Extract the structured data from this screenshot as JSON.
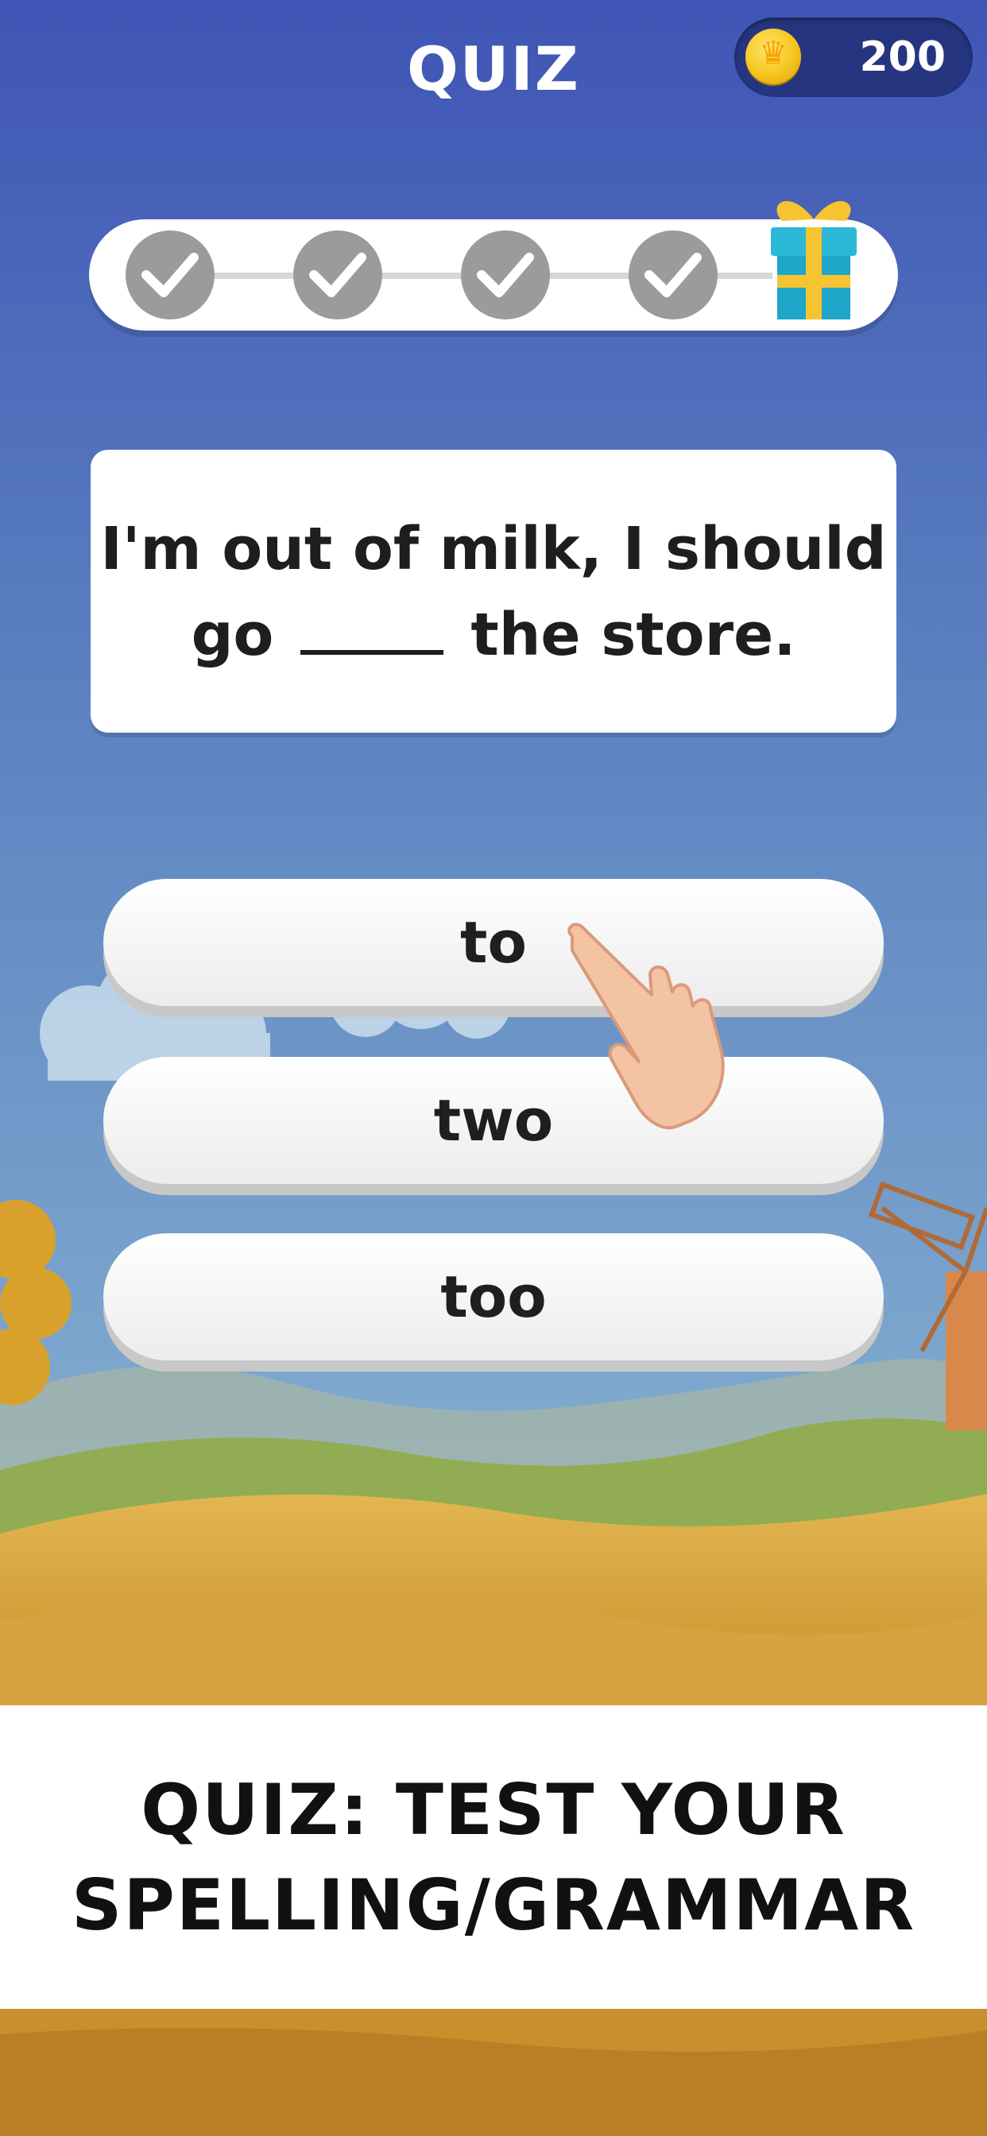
{
  "header": {
    "title": "QUIZ",
    "coin_count": "200"
  },
  "progress": {
    "completed_steps": 4,
    "total_steps": 5,
    "reward_icon": "gift-icon"
  },
  "question": {
    "line1": "I'm out of milk, I should",
    "line2_before": "go",
    "line2_after": "the store."
  },
  "answers": [
    {
      "label": "to"
    },
    {
      "label": "two"
    },
    {
      "label": "too"
    }
  ],
  "banner": {
    "line1": "QUIZ: TEST YOUR",
    "line2": "SPELLING/GRAMMAR"
  },
  "colors": {
    "sky_top": "#3f55b5",
    "sky_bottom": "#7fb0d2",
    "field": "#d9a93c",
    "step_done": "#9b9b9b"
  }
}
